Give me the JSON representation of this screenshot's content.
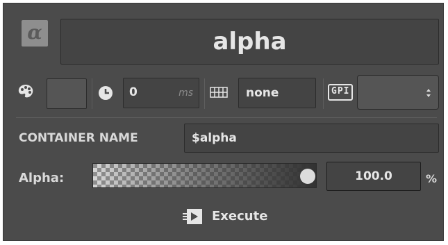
{
  "header": {
    "icon": "alpha-symbol-icon",
    "glyph": "α",
    "title": "alpha"
  },
  "toolbar": {
    "palette_icon": "palette-icon",
    "clock_icon": "clock-icon",
    "duration_value": "0",
    "duration_unit": "ms",
    "grid_icon": "keyboard-grid-icon",
    "easing_value": "none",
    "gpi_label": "GPI",
    "gpi_value": ""
  },
  "container": {
    "label": "CONTAINER NAME",
    "value": "$alpha"
  },
  "alpha": {
    "label": "Alpha:",
    "value": "100.0",
    "unit": "%",
    "level": 1.0
  },
  "execute": {
    "label": "Execute",
    "icon": "execute-icon"
  },
  "colors": {
    "panel": "#4b4b4b",
    "field": "#444444",
    "text": "#e6e6e6"
  }
}
